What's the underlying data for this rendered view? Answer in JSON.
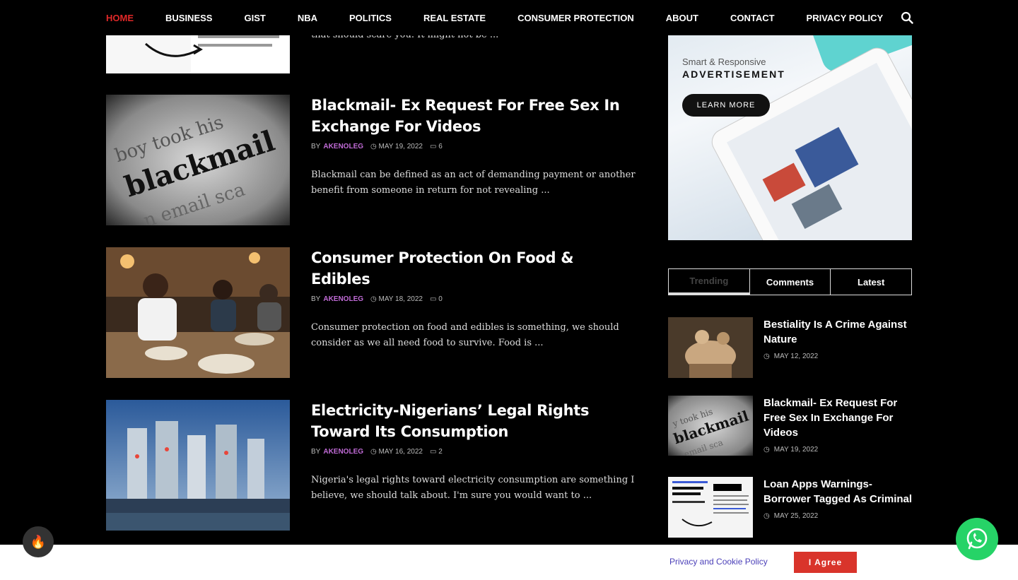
{
  "nav": {
    "items": [
      "HOME",
      "BUSINESS",
      "GIST",
      "NBA",
      "POLITICS",
      "REAL ESTATE",
      "CONSUMER PROTECTION",
      "ABOUT",
      "CONTACT",
      "PRIVACY POLICY"
    ]
  },
  "top_partial": {
    "excerpt": "that should scare you. It might not be ..."
  },
  "posts": [
    {
      "title": "Blackmail- Ex Request For Free Sex In Exchange For Videos",
      "by": "BY",
      "author": "AKENOLEG",
      "date": "MAY 19, 2022",
      "comments": "6",
      "excerpt": "Blackmail can be defined as an act of demanding payment or another benefit from someone in return for not revealing ..."
    },
    {
      "title": "Consumer Protection On Food & Edibles",
      "by": "BY",
      "author": "AKENOLEG",
      "date": "MAY 18, 2022",
      "comments": "0",
      "excerpt": "Consumer protection on food and edibles is something, we should consider as we all need food to survive. Food is ..."
    },
    {
      "title": "Electricity-Nigerians’ Legal Rights Toward Its Consumption",
      "by": "BY",
      "author": "AKENOLEG",
      "date": "MAY 16, 2022",
      "comments": "2",
      "excerpt": " Nigeria's legal rights toward electricity consumption are something I believe, we should talk about. I'm sure you would want to ..."
    }
  ],
  "ad": {
    "small": "Smart & Responsive",
    "big": "ADVERTISEMENT",
    "button": "LEARN MORE"
  },
  "tabs": [
    "Trending",
    "Comments",
    "Latest"
  ],
  "sidebar": [
    {
      "title": "Bestiality Is A Crime Against Nature",
      "date": "MAY 12, 2022"
    },
    {
      "title": "Blackmail- Ex Request For Free Sex In Exchange For Videos",
      "date": "MAY 19, 2022"
    },
    {
      "title": "Loan Apps Warnings- Borrower Tagged As Criminal",
      "date": "MAY 25, 2022"
    }
  ],
  "cookie": {
    "text": "Privacy and Cookie Policy",
    "button": "I Agree"
  },
  "colors": {
    "accent": "#e02828",
    "author": "#c06bd6",
    "whatsapp": "#26d367",
    "agree": "#d9342b"
  }
}
